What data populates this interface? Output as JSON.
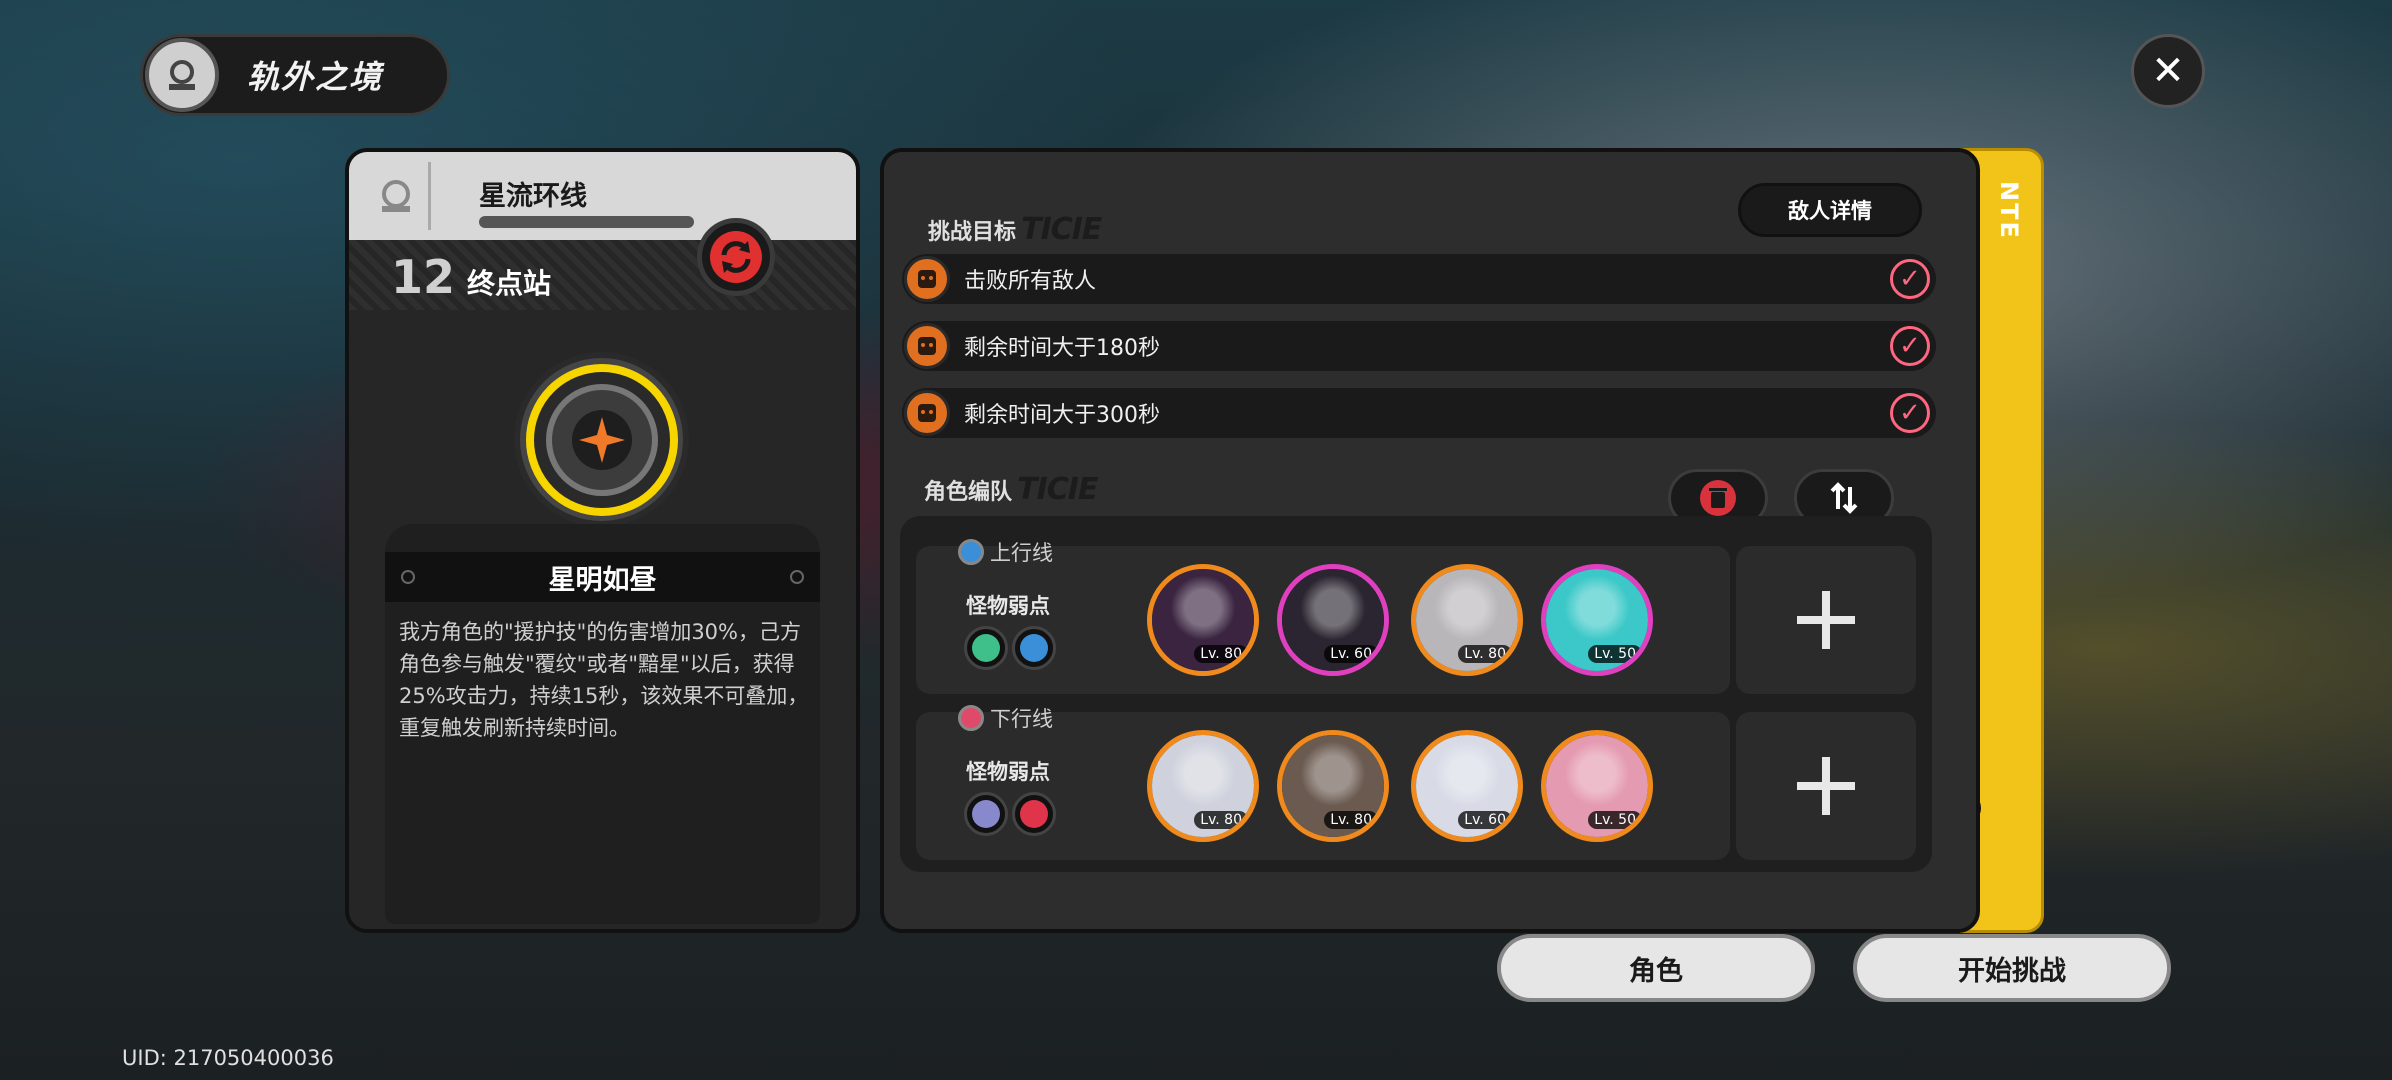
{
  "header": {
    "title": "轨外之境"
  },
  "left_card": {
    "route_name": "星流环线",
    "stage_number": "12",
    "stage_name": "终点站",
    "buff_title": "星明如昼",
    "buff_description": "我方角色的\"援护技\"的伤害增加30%，己方角色参与触发\"覆纹\"或者\"黯星\"以后，获得25%攻击力，持续15秒，该效果不可叠加，重复触发刷新持续时间。"
  },
  "objectives": {
    "section_label": "挑战目标",
    "section_deco": "TICIE",
    "enemy_detail_label": "敌人详情",
    "items": [
      {
        "text": "击败所有敌人"
      },
      {
        "text": "剩余时间大于180秒"
      },
      {
        "text": "剩余时间大于300秒"
      }
    ]
  },
  "team": {
    "section_label": "角色编队",
    "section_deco": "TICIE",
    "lanes": [
      {
        "tag": "上行线",
        "weak_label": "怪物弱点",
        "weak_colors": [
          "#3fbf8a",
          "#3a8fd8"
        ],
        "characters": [
          {
            "lv": "Lv. 80",
            "ring": "#f08a1c",
            "bg": "#3a2440"
          },
          {
            "lv": "Lv. 60",
            "ring": "#e040c0",
            "bg": "#2a2530"
          },
          {
            "lv": "Lv. 80",
            "ring": "#f08a1c",
            "bg": "#b8b6b8"
          },
          {
            "lv": "Lv. 50",
            "ring": "#e040c0",
            "bg": "#3cc8c8"
          }
        ]
      },
      {
        "tag": "下行线",
        "weak_label": "怪物弱点",
        "weak_colors": [
          "#8888cc",
          "#e0344a"
        ],
        "characters": [
          {
            "lv": "Lv. 80",
            "ring": "#f08a1c",
            "bg": "#cfd2dc"
          },
          {
            "lv": "Lv. 80",
            "ring": "#f08a1c",
            "bg": "#6a5a50"
          },
          {
            "lv": "Lv. 60",
            "ring": "#f08a1c",
            "bg": "#d8dbe6"
          },
          {
            "lv": "Lv. 50",
            "ring": "#f08a1c",
            "bg": "#e49ab0"
          }
        ]
      }
    ]
  },
  "side_tab": {
    "text": "NTE"
  },
  "buttons": {
    "character": "角色",
    "start": "开始挑战"
  },
  "uid": "UID: 217050400036",
  "colors": {
    "accent_yellow": "#f2c318",
    "check_pink": "#ff6680",
    "objective_orange": "#e07020"
  }
}
